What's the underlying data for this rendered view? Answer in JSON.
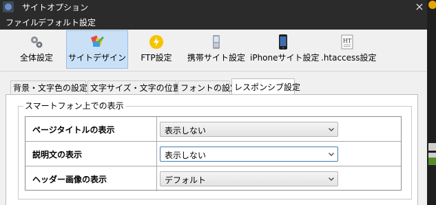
{
  "window": {
    "title": "サイトオプション",
    "close_glyph": "×"
  },
  "menu": {
    "items": [
      {
        "label": "ファイル"
      },
      {
        "label": "デフォルト設定"
      }
    ]
  },
  "toolbar": {
    "buttons": [
      {
        "label": "全体設定",
        "icon": "gears-icon",
        "active": false
      },
      {
        "label": "サイトデザイン",
        "icon": "design-palette-icon",
        "active": true
      },
      {
        "label": "FTP設定",
        "icon": "ftp-lightning-icon",
        "active": false
      },
      {
        "label": "携帯サイト設定",
        "icon": "mobile-phone-icon",
        "active": false
      },
      {
        "label": "iPhoneサイト設定",
        "icon": "iphone-icon",
        "active": false
      },
      {
        "label": ".htaccess設定",
        "icon": "htaccess-document-icon",
        "active": false,
        "icon_text": "HT"
      }
    ]
  },
  "tabs": [
    {
      "label": "背景・文字色の設定",
      "active": false
    },
    {
      "label": "文字サイズ・文字の位置",
      "active": false
    },
    {
      "label": "フォントの設定",
      "active": false
    },
    {
      "label": "レスポンシブ設定",
      "active": true
    }
  ],
  "group": {
    "legend": "スマートフォン上での表示",
    "rows": [
      {
        "label": "ページタイトルの表示",
        "value": "表示しない",
        "focused": false
      },
      {
        "label": "説明文の表示",
        "value": "表示しない",
        "focused": true
      },
      {
        "label": "ヘッダー画像の表示",
        "value": "デフォルト",
        "focused": false
      }
    ]
  },
  "colors": {
    "titlebar_bg": "#2b2b2b",
    "toolbar_active_bg": "#c9e0f7",
    "focus_border": "#3c7fb1"
  }
}
